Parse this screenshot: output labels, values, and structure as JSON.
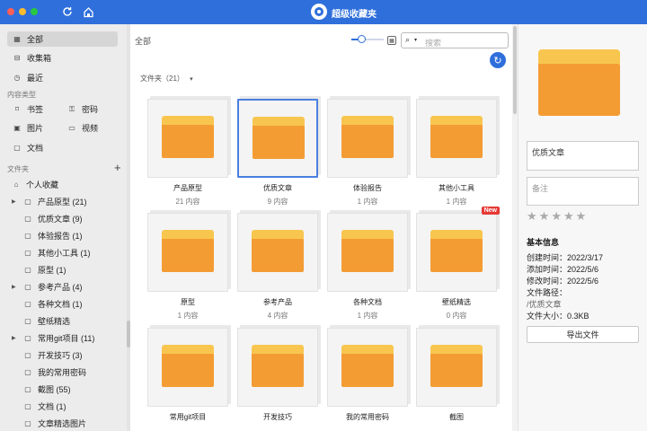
{
  "window": {
    "title": "超级收藏夹",
    "accent": "#2f6fdb"
  },
  "sidebar": {
    "top_items": [
      {
        "label": "全部",
        "icon": "grid-icon",
        "active": true
      },
      {
        "label": "收集箱",
        "icon": "inbox-icon"
      },
      {
        "label": "最近",
        "icon": "clock-icon"
      }
    ],
    "content_types_header": "内容类型",
    "content_types": [
      {
        "label": "书签",
        "icon": "bookmark-icon"
      },
      {
        "label": "密码",
        "icon": "key-icon"
      },
      {
        "label": "图片",
        "icon": "image-icon"
      },
      {
        "label": "视频",
        "icon": "video-icon"
      },
      {
        "label": "文档",
        "icon": "document-icon"
      }
    ],
    "folders_header": "文件夹",
    "add_symbol": "+",
    "root_folder": "个人收藏",
    "folders": [
      {
        "label": "产品原型 (21)",
        "expandable": true
      },
      {
        "label": "优质文章 (9)",
        "expandable": false
      },
      {
        "label": "体验报告 (1)",
        "expandable": false
      },
      {
        "label": "其他小工具 (1)",
        "expandable": false
      },
      {
        "label": "原型 (1)",
        "expandable": false
      },
      {
        "label": "参考产品 (4)",
        "expandable": true
      },
      {
        "label": "各种文档 (1)",
        "expandable": false
      },
      {
        "label": "壁纸精选",
        "expandable": false
      },
      {
        "label": "常用git项目 (11)",
        "expandable": true
      },
      {
        "label": "开发技巧 (3)",
        "expandable": false
      },
      {
        "label": "我的常用密码",
        "expandable": false
      },
      {
        "label": "截图 (55)",
        "expandable": false
      },
      {
        "label": "文档 (1)",
        "expandable": false
      },
      {
        "label": "文章精选图片",
        "expandable": false
      }
    ]
  },
  "main": {
    "breadcrumb": "全部",
    "zoom_fraction": 0.3,
    "search_placeholder": "搜索",
    "folder_count_label": "文件夹（21）",
    "cards": [
      {
        "title": "产品原型",
        "count": "21 内容"
      },
      {
        "title": "优质文章",
        "count": "9 内容",
        "selected": true
      },
      {
        "title": "体验报告",
        "count": "1 内容"
      },
      {
        "title": "其他小工具",
        "count": "1 内容"
      },
      {
        "title": "原型",
        "count": "1 内容"
      },
      {
        "title": "参考产品",
        "count": "4 内容"
      },
      {
        "title": "各种文档",
        "count": "1 内容"
      },
      {
        "title": "壁纸精选",
        "count": "0 内容",
        "badge": "New"
      },
      {
        "title": "常用git项目",
        "count": ""
      },
      {
        "title": "开发技巧",
        "count": ""
      },
      {
        "title": "我的常用密码",
        "count": ""
      },
      {
        "title": "截图",
        "count": ""
      }
    ]
  },
  "panel": {
    "name_value": "优质文章",
    "note_placeholder": "备注",
    "rating": 0,
    "info_header": "基本信息",
    "info": [
      "创建时间：2022/3/17",
      "添加时间：2022/5/6",
      "修改时间：2022/5/6",
      "文件路径：",
      "/优质文章",
      "文件大小：0.3KB"
    ],
    "export_label": "导出文件"
  }
}
